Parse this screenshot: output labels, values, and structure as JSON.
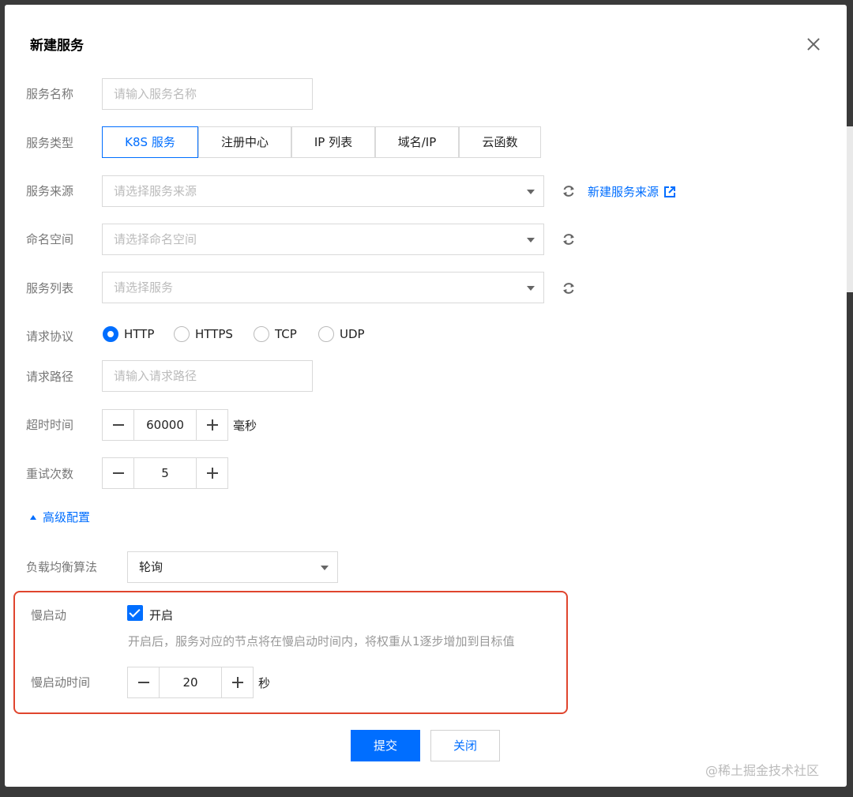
{
  "dialog": {
    "title": "新建服务"
  },
  "form": {
    "service_name": {
      "label": "服务名称",
      "placeholder": "请输入服务名称"
    },
    "service_type": {
      "label": "服务类型",
      "options": [
        "K8S 服务",
        "注册中心",
        "IP 列表",
        "域名/IP",
        "云函数"
      ],
      "selected": "K8S 服务"
    },
    "service_source": {
      "label": "服务来源",
      "placeholder": "请选择服务来源",
      "link": "新建服务来源"
    },
    "namespace": {
      "label": "命名空间",
      "placeholder": "请选择命名空间"
    },
    "service_list": {
      "label": "服务列表",
      "placeholder": "请选择服务"
    },
    "protocol": {
      "label": "请求协议",
      "options": [
        "HTTP",
        "HTTPS",
        "TCP",
        "UDP"
      ],
      "selected": "HTTP"
    },
    "path": {
      "label": "请求路径",
      "placeholder": "请输入请求路径"
    },
    "timeout": {
      "label": "超时时间",
      "value": "60000",
      "unit": "毫秒"
    },
    "retries": {
      "label": "重试次数",
      "value": "5"
    },
    "advanced_toggle": "高级配置",
    "load_balance": {
      "label": "负载均衡算法",
      "value": "轮询"
    },
    "slow_start": {
      "label": "慢启动",
      "checkbox_label": "开启",
      "checked": true,
      "hint": "开启后，服务对应的节点将在慢启动时间内，将权重从1逐步增加到目标值"
    },
    "slow_start_time": {
      "label": "慢启动时间",
      "value": "20",
      "unit": "秒"
    }
  },
  "footer": {
    "submit_label": "提交",
    "close_label": "关闭"
  },
  "watermark": "@稀土掘金技术社区",
  "colors": {
    "accent": "#006eff",
    "highlight_border": "#e0452e"
  }
}
